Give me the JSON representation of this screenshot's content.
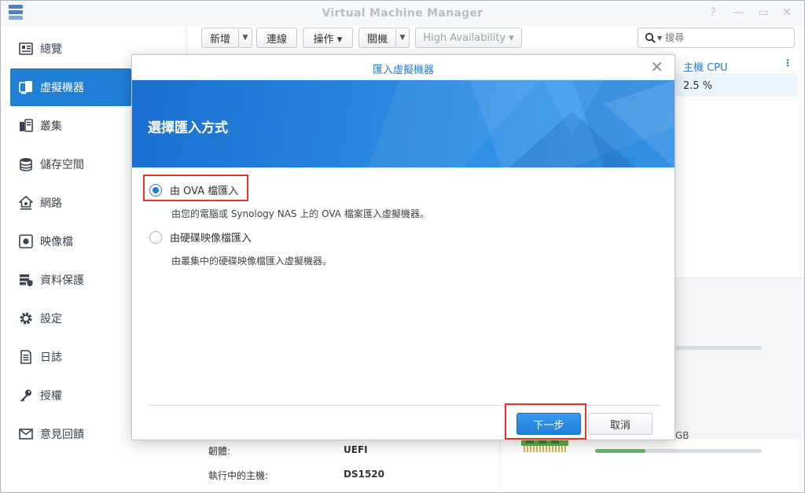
{
  "window": {
    "title": "Virtual Machine Manager",
    "controls": [
      "?",
      "—",
      "▭",
      "✕"
    ]
  },
  "sidebar": {
    "items": [
      {
        "label": "總覽",
        "icon": "overview-icon"
      },
      {
        "label": "虛擬機器",
        "icon": "virtual-machine-icon",
        "active": true
      },
      {
        "label": "叢集",
        "icon": "cluster-icon"
      },
      {
        "label": "儲存空間",
        "icon": "storage-icon"
      },
      {
        "label": "網路",
        "icon": "network-icon"
      },
      {
        "label": "映像檔",
        "icon": "image-icon"
      },
      {
        "label": "資料保護",
        "icon": "data-protection-icon"
      },
      {
        "label": "設定",
        "icon": "settings-gear-icon"
      },
      {
        "label": "日誌",
        "icon": "log-icon"
      },
      {
        "label": "授權",
        "icon": "license-key-icon"
      },
      {
        "label": "意見回饋",
        "icon": "feedback-mail-icon"
      }
    ]
  },
  "toolbar": {
    "create": "新增",
    "connect": "連線",
    "action": "操作 ▾",
    "shutdown": "關機",
    "ha": "High Availability ▾",
    "search_placeholder": "搜尋"
  },
  "vm_list": {
    "column_host_cpu": "主機 CPU",
    "host_cpu_value": "2.5 %"
  },
  "details": {
    "firmware_label": "韌體:",
    "firmware_value": "UEFI",
    "running_host_label": "執行中的主機:",
    "running_host_value": "DS1520",
    "ram_unit": "GB",
    "ram_usage_fraction": 0.3
  },
  "dialog": {
    "title": "匯入虛擬機器",
    "banner_title": "選擇匯入方式",
    "options": [
      {
        "label": "由 OVA 檔匯入",
        "desc": "由您的電腦或 Synology NAS 上的 OVA 檔案匯入虛擬機器。",
        "selected": true
      },
      {
        "label": "由硬碟映像檔匯入",
        "desc": "由叢集中的硬碟映像檔匯入虛擬機器。",
        "selected": false
      }
    ],
    "next": "下一步",
    "cancel": "取消"
  },
  "colors": {
    "accent": "#1f7ed6",
    "highlight": "#e0352b"
  }
}
